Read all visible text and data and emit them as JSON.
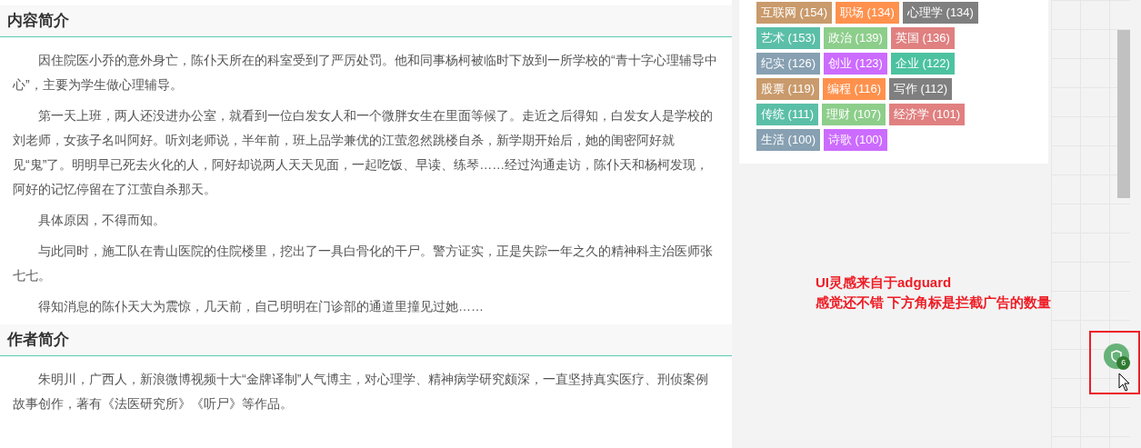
{
  "sections": [
    {
      "title": "内容简介",
      "paragraphs": [
        "因住院医小乔的意外身亡，陈仆天所在的科室受到了严厉处罚。他和同事杨柯被临时下放到一所学校的“青十字心理辅导中心”，主要为学生做心理辅导。",
        "第一天上班，两人还没进办公室，就看到一位白发女人和一个微胖女生在里面等候了。走近之后得知，白发女人是学校的刘老师，女孩子名叫阿好。听刘老师说，半年前，班上品学兼优的江萤忽然跳楼自杀，新学期开始后，她的闺密阿好就见“鬼”了。明明早已死去火化的人，阿好却说两人天天见面，一起吃饭、早读、练琴……经过沟通走访，陈仆天和杨柯发现，阿好的记忆停留在了江萤自杀那天。",
        "具体原因，不得而知。",
        "与此同时，施工队在青山医院的住院楼里，挖出了一具白骨化的干尸。警方证实，正是失踪一年之久的精神科主治医师张七七。",
        "得知消息的陈仆天大为震惊，几天前，自己明明在门诊部的通道里撞见过她……"
      ]
    },
    {
      "title": "作者简介",
      "paragraphs": [
        "朱明川，广西人，新浪微博视频十大“金牌译制”人气博主，对心理学、精神病学研究颇深，一直坚持真实医疗、刑侦案例故事创作，著有《法医研究所》《听尸》等作品。"
      ]
    }
  ],
  "tags": [
    {
      "label": "互联网 (154)",
      "color": "#c99a6b"
    },
    {
      "label": "职场 (134)",
      "color": "#ff914d"
    },
    {
      "label": "心理学 (134)",
      "color": "#7f7f7f"
    },
    {
      "label": "艺术 (153)",
      "color": "#5bbfa8"
    },
    {
      "label": "政治 (139)",
      "color": "#8dce8b"
    },
    {
      "label": "英国 (136)",
      "color": "#e08080"
    },
    {
      "label": "纪实 (126)",
      "color": "#87a0b2"
    },
    {
      "label": "创业 (123)",
      "color": "#cc6bff"
    },
    {
      "label": "企业 (122)",
      "color": "#4cc2a0"
    },
    {
      "label": "股票 (119)",
      "color": "#c99a6b"
    },
    {
      "label": "编程 (116)",
      "color": "#ff914d"
    },
    {
      "label": "写作 (112)",
      "color": "#7f7f7f"
    },
    {
      "label": "传统 (111)",
      "color": "#5bbfa8"
    },
    {
      "label": "理财 (107)",
      "color": "#8dce8b"
    },
    {
      "label": "经济学 (101)",
      "color": "#e08080"
    },
    {
      "label": "生活 (100)",
      "color": "#87a0b2"
    },
    {
      "label": "诗歌 (100)",
      "color": "#cc6bff"
    }
  ],
  "annotation": [
    "UI灵感来自于adguard",
    "感觉还不错 下方角标是拦截广告的数量"
  ],
  "blocker_button": {
    "badge": "6"
  }
}
